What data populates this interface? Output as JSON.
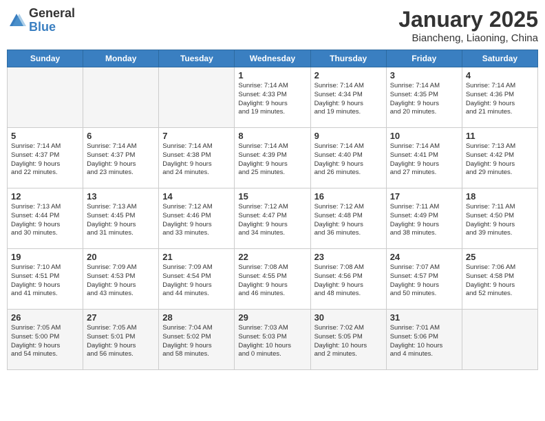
{
  "header": {
    "logo": {
      "general": "General",
      "blue": "Blue"
    },
    "title": "January 2025",
    "subtitle": "Biancheng, Liaoning, China"
  },
  "days_of_week": [
    "Sunday",
    "Monday",
    "Tuesday",
    "Wednesday",
    "Thursday",
    "Friday",
    "Saturday"
  ],
  "weeks": [
    [
      {
        "day": "",
        "info": ""
      },
      {
        "day": "",
        "info": ""
      },
      {
        "day": "",
        "info": ""
      },
      {
        "day": "1",
        "info": "Sunrise: 7:14 AM\nSunset: 4:33 PM\nDaylight: 9 hours\nand 19 minutes."
      },
      {
        "day": "2",
        "info": "Sunrise: 7:14 AM\nSunset: 4:34 PM\nDaylight: 9 hours\nand 19 minutes."
      },
      {
        "day": "3",
        "info": "Sunrise: 7:14 AM\nSunset: 4:35 PM\nDaylight: 9 hours\nand 20 minutes."
      },
      {
        "day": "4",
        "info": "Sunrise: 7:14 AM\nSunset: 4:36 PM\nDaylight: 9 hours\nand 21 minutes."
      }
    ],
    [
      {
        "day": "5",
        "info": "Sunrise: 7:14 AM\nSunset: 4:37 PM\nDaylight: 9 hours\nand 22 minutes."
      },
      {
        "day": "6",
        "info": "Sunrise: 7:14 AM\nSunset: 4:37 PM\nDaylight: 9 hours\nand 23 minutes."
      },
      {
        "day": "7",
        "info": "Sunrise: 7:14 AM\nSunset: 4:38 PM\nDaylight: 9 hours\nand 24 minutes."
      },
      {
        "day": "8",
        "info": "Sunrise: 7:14 AM\nSunset: 4:39 PM\nDaylight: 9 hours\nand 25 minutes."
      },
      {
        "day": "9",
        "info": "Sunrise: 7:14 AM\nSunset: 4:40 PM\nDaylight: 9 hours\nand 26 minutes."
      },
      {
        "day": "10",
        "info": "Sunrise: 7:14 AM\nSunset: 4:41 PM\nDaylight: 9 hours\nand 27 minutes."
      },
      {
        "day": "11",
        "info": "Sunrise: 7:13 AM\nSunset: 4:42 PM\nDaylight: 9 hours\nand 29 minutes."
      }
    ],
    [
      {
        "day": "12",
        "info": "Sunrise: 7:13 AM\nSunset: 4:44 PM\nDaylight: 9 hours\nand 30 minutes."
      },
      {
        "day": "13",
        "info": "Sunrise: 7:13 AM\nSunset: 4:45 PM\nDaylight: 9 hours\nand 31 minutes."
      },
      {
        "day": "14",
        "info": "Sunrise: 7:12 AM\nSunset: 4:46 PM\nDaylight: 9 hours\nand 33 minutes."
      },
      {
        "day": "15",
        "info": "Sunrise: 7:12 AM\nSunset: 4:47 PM\nDaylight: 9 hours\nand 34 minutes."
      },
      {
        "day": "16",
        "info": "Sunrise: 7:12 AM\nSunset: 4:48 PM\nDaylight: 9 hours\nand 36 minutes."
      },
      {
        "day": "17",
        "info": "Sunrise: 7:11 AM\nSunset: 4:49 PM\nDaylight: 9 hours\nand 38 minutes."
      },
      {
        "day": "18",
        "info": "Sunrise: 7:11 AM\nSunset: 4:50 PM\nDaylight: 9 hours\nand 39 minutes."
      }
    ],
    [
      {
        "day": "19",
        "info": "Sunrise: 7:10 AM\nSunset: 4:51 PM\nDaylight: 9 hours\nand 41 minutes."
      },
      {
        "day": "20",
        "info": "Sunrise: 7:09 AM\nSunset: 4:53 PM\nDaylight: 9 hours\nand 43 minutes."
      },
      {
        "day": "21",
        "info": "Sunrise: 7:09 AM\nSunset: 4:54 PM\nDaylight: 9 hours\nand 44 minutes."
      },
      {
        "day": "22",
        "info": "Sunrise: 7:08 AM\nSunset: 4:55 PM\nDaylight: 9 hours\nand 46 minutes."
      },
      {
        "day": "23",
        "info": "Sunrise: 7:08 AM\nSunset: 4:56 PM\nDaylight: 9 hours\nand 48 minutes."
      },
      {
        "day": "24",
        "info": "Sunrise: 7:07 AM\nSunset: 4:57 PM\nDaylight: 9 hours\nand 50 minutes."
      },
      {
        "day": "25",
        "info": "Sunrise: 7:06 AM\nSunset: 4:58 PM\nDaylight: 9 hours\nand 52 minutes."
      }
    ],
    [
      {
        "day": "26",
        "info": "Sunrise: 7:05 AM\nSunset: 5:00 PM\nDaylight: 9 hours\nand 54 minutes."
      },
      {
        "day": "27",
        "info": "Sunrise: 7:05 AM\nSunset: 5:01 PM\nDaylight: 9 hours\nand 56 minutes."
      },
      {
        "day": "28",
        "info": "Sunrise: 7:04 AM\nSunset: 5:02 PM\nDaylight: 9 hours\nand 58 minutes."
      },
      {
        "day": "29",
        "info": "Sunrise: 7:03 AM\nSunset: 5:03 PM\nDaylight: 10 hours\nand 0 minutes."
      },
      {
        "day": "30",
        "info": "Sunrise: 7:02 AM\nSunset: 5:05 PM\nDaylight: 10 hours\nand 2 minutes."
      },
      {
        "day": "31",
        "info": "Sunrise: 7:01 AM\nSunset: 5:06 PM\nDaylight: 10 hours\nand 4 minutes."
      },
      {
        "day": "",
        "info": ""
      }
    ]
  ]
}
